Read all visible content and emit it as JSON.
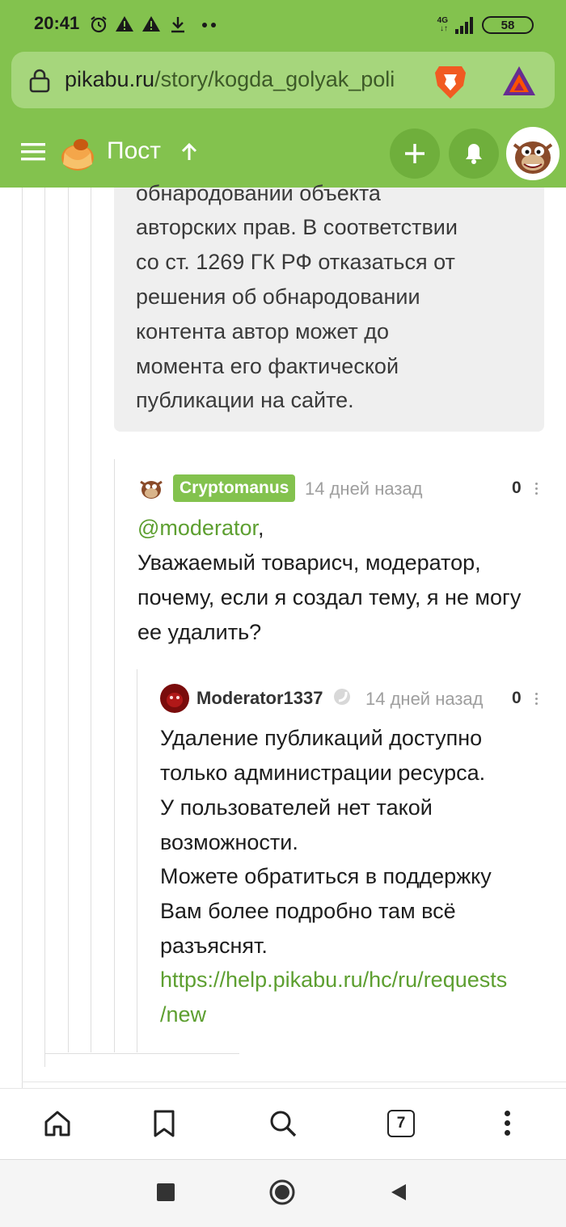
{
  "status_bar": {
    "time": "20:41",
    "network": "4G",
    "battery": "58"
  },
  "browser": {
    "url_host": "pikabu.ru",
    "url_path": "/story/kogda_golyak_poli",
    "tab_count": "7"
  },
  "header": {
    "title": "Пост"
  },
  "quote_block": {
    "lines": [
      "обнародовании объекта",
      "авторских прав. В соответствии",
      "со ст. 1269 ГК РФ отказаться от",
      "решения об обнародовании",
      "контента автор может до",
      "момента его фактической",
      "публикации на сайте."
    ]
  },
  "comment1": {
    "author": "Cryptomanus",
    "time": "14 дней назад",
    "score": "0",
    "mention": "@moderator",
    "lines": [
      "Уважаемый товарисч, модератор,",
      "почему, если я создал тему, я не могу",
      "ее удалить?"
    ]
  },
  "comment2": {
    "author": "Moderator1337",
    "time": "14 дней назад",
    "score": "0",
    "lines": [
      "Удаление публикаций доступно",
      "только администрации ресурса.",
      "У пользователей нет такой",
      "возможности.",
      "Можете обратиться в поддержку",
      "Вам более подробно там всё",
      "разъяснят."
    ],
    "link_lines": [
      "https://help.pikabu.ru/hc/ru/requests",
      "/new"
    ]
  },
  "colors": {
    "brand_green": "#83c24e",
    "link_green": "#5d9f30"
  },
  "icons": [
    "alarm-icon",
    "warning-icon",
    "download-icon",
    "lock-icon",
    "brave-lion-icon",
    "bat-triangle-icon",
    "menu-icon",
    "pikabu-logo-icon",
    "arrow-up-icon",
    "plus-icon",
    "bell-icon",
    "home-icon",
    "bookmark-icon",
    "search-icon",
    "more-vert-icon"
  ]
}
